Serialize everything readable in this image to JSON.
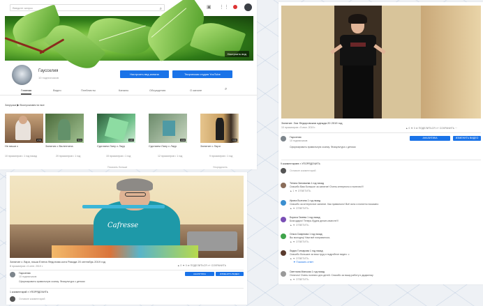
{
  "channel_page": {
    "search_placeholder": "Введите запрос",
    "search_icon": "magnifier-icon",
    "banner_button": "Настроить вид",
    "channel_name": "Гаусселия",
    "subscribers": "10 подписчиков",
    "btn_customize": "Настроить вид канала",
    "btn_manage": "Творческая студия YouTube",
    "tabs": [
      "Главная",
      "Видео",
      "Плейлисты",
      "Каналы",
      "Обсуждения",
      "О канале"
    ],
    "section_title": "Загрузки   ▶ Воспроизвести все",
    "videos": [
      {
        "title": "Не ваши с",
        "meta": "10 просмотров • 1 год назад",
        "dur": "2:04"
      },
      {
        "title": "Занятия с Валентина",
        "meta": "20 просмотров • 1 год",
        "dur": "5:11"
      },
      {
        "title": "Сделаем Лапу с Лаур",
        "meta": "15 просмотров • 1 год",
        "dur": "3:47"
      },
      {
        "title": "Сделаем Лапу с Лаур",
        "meta": "12 просмотров • 1 год",
        "dur": "4:02"
      },
      {
        "title": "Занятие с Лари",
        "meta": "9 просмотров • 1 год",
        "dur": "6:30"
      }
    ],
    "footer_left": "Показать больше",
    "footer_right": "Упорядочить"
  },
  "comments_page": {
    "video_title": "Занятие: Зоя Федоровская одежда 20 2019 год",
    "video_meta": "10 просмотров • 5 июл. 2019 г.",
    "likes": "▲ 0   ▼ 0   ➦ ПОДЕЛИТЬСЯ   ≡+ СОХРАНИТЬ   ···",
    "btn_analytics": "АНАЛИТИКА",
    "btn_edit": "ИЗМЕНИТЬ ВИДЕО",
    "author_name": "Гаусселия",
    "author_subs": "10 подписчиков",
    "description": "Сформировать правильную осанку. Физкультура с детьми",
    "comments_count": "9 комментариев   ≡ УПОРЯДОЧИТЬ",
    "add_comment": "Оставьте комментарий",
    "comments": [
      {
        "name": "Тетяна Зиновьева  1 год назад",
        "text": "Спасибо Вам большое за занятие! Очень интересно и полезно!!!",
        "acts": "▲ 1  ▼  ОТВЕТИТЬ",
        "color": "#8a6d5a",
        "replies": ""
      },
      {
        "name": "Ирина Волгина  1 год назад",
        "text": "Спасибо за интересное занятие. Как правильно! Всё ясно и понятно показано",
        "acts": "▲  ▼  ОТВЕТИТЬ",
        "color": "#3b8fd0",
        "replies": ""
      },
      {
        "name": "Бориса Ганева  1 год назад",
        "text": "Благодарю! Теперь будем делать вместе!!!",
        "acts": "▲  ▼  ОТВЕТИТЬ",
        "color": "#7a4fb5",
        "replies": ""
      },
      {
        "name": "Ольга Смирнова  1 год назад",
        "text": "Вы молодец! Нам всё понравилось",
        "acts": "▲  ▼  ОТВЕТИТЬ",
        "color": "#3ea34a",
        "replies": ""
      },
      {
        "name": "Лидия Гончарова  1 год назад",
        "text": "Спасибо большое за ваш труд и подробное видео ☺",
        "acts": "▲  ▼  ОТВЕТИТЬ",
        "color": "#5a3b2e",
        "replies": "▼ Показать ответ"
      },
      {
        "name": "Светлана Минская  1 год назад",
        "text": "Отлично! Очень полезно для детей. Спасибо за вашу работу и дидактику",
        "acts": "▲  ▼  ОТВЕТИТЬ",
        "color": "#9a9a9a",
        "replies": ""
      }
    ]
  },
  "video_page": {
    "video_title": "Занятие с Лари, наша Елена Федотова кота Разиди 20 сентябрь 2019 год",
    "video_meta": "8 просмотров • 6 сент. 2019 г.",
    "likes": "▲ 0   ▼ 0   ➦ ПОДЕЛИТЬСЯ   ≡+ СОХРАНИТЬ",
    "btn_analytics": "АНАЛИТИКА",
    "btn_edit": "ИЗМЕНИТЬ ВИДЕО",
    "author_name": "Гаусселия",
    "author_subs": "10 подписчиков",
    "description": "Сформировать правильную осанку. Физкультура с детьми",
    "comments_count": "1 комментарий   ≡ УПОРЯДОЧИТЬ",
    "first_comment": "Оставьте комментарий",
    "shirt_text": "Cafresse"
  }
}
